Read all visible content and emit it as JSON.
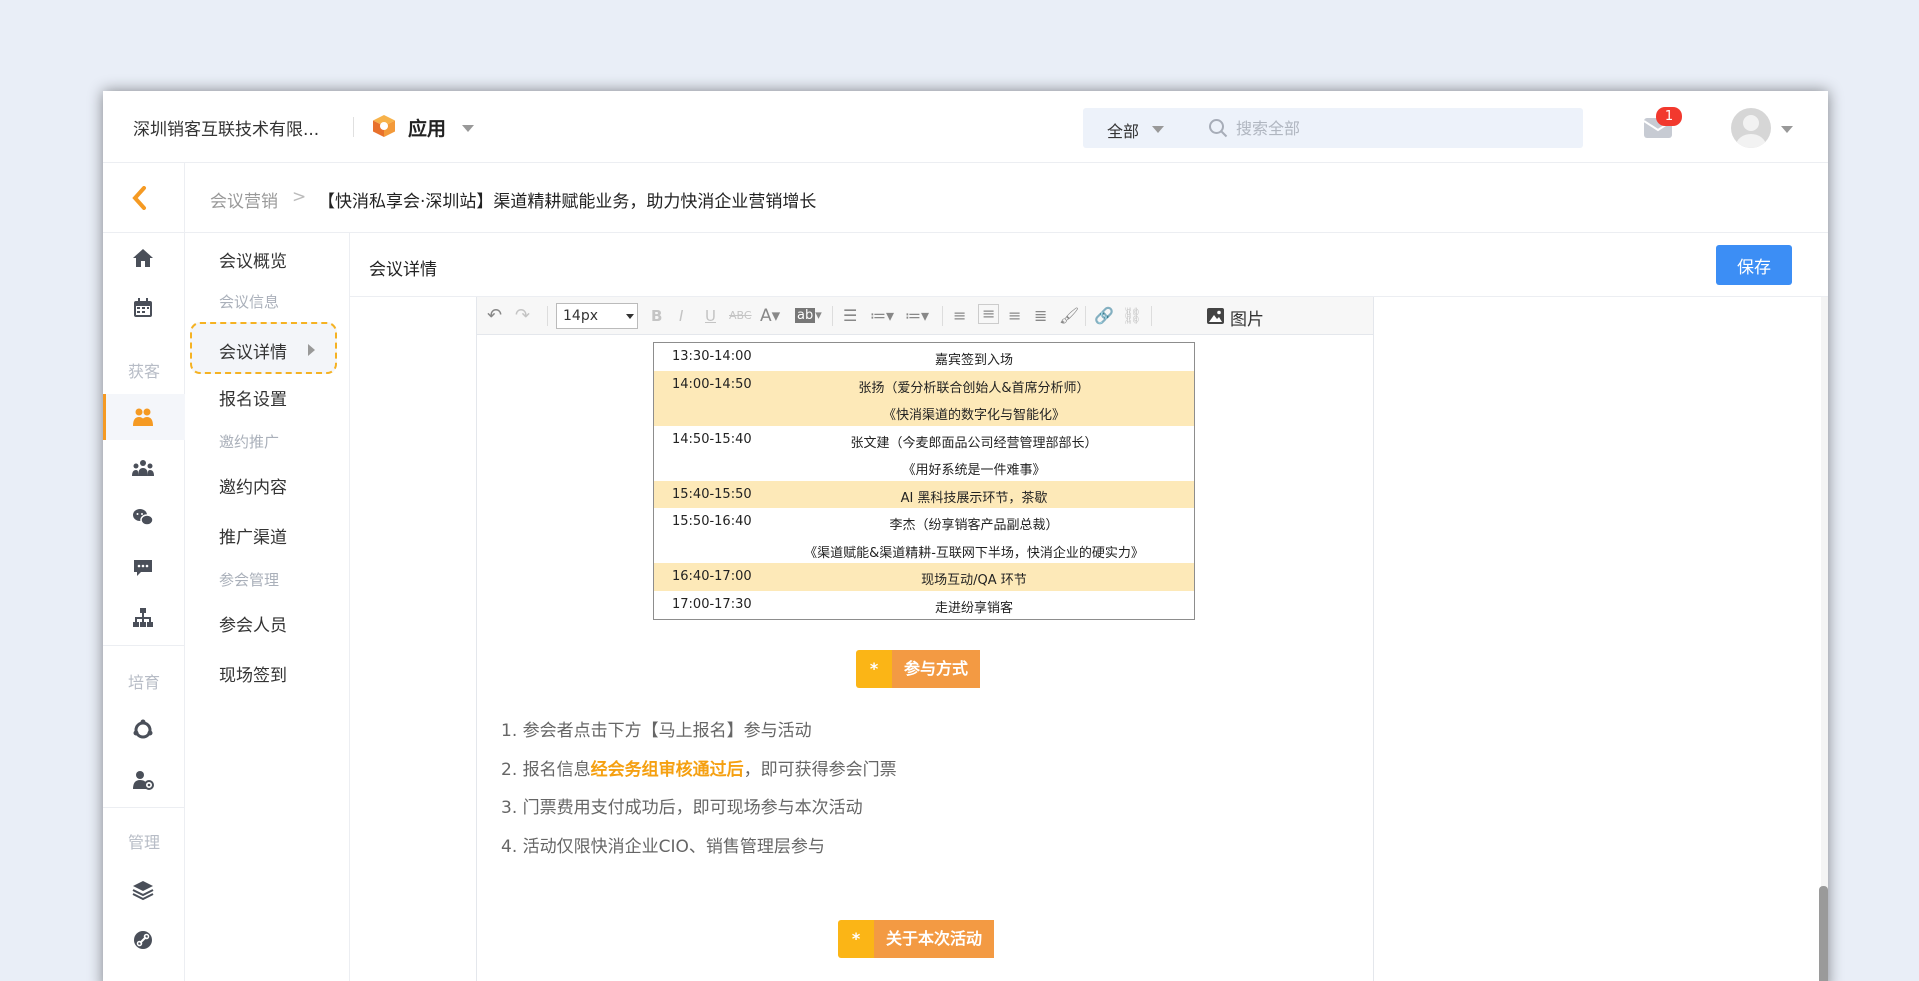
{
  "topbar": {
    "company": "深圳销客互联技术有限...",
    "app_label": "应用",
    "search_scope": "全部",
    "search_placeholder": "搜索全部",
    "mail_badge": "1"
  },
  "breadcrumb": {
    "parent": "会议营销",
    "separator": ">",
    "current": "【快消私享会·深圳站】渠道精耕赋能业务，助力快消企业营销增长"
  },
  "rail": {
    "group_labels": [
      "获客",
      "培育",
      "管理"
    ],
    "icons": [
      "home-icon",
      "calendar-icon",
      "leads-icon",
      "users-group-icon",
      "wechat-icon",
      "chat-icon",
      "org-chart-icon",
      "cycle-icon",
      "user-setting-icon",
      "layers-icon",
      "link-icon"
    ]
  },
  "submenu": {
    "overview": "会议概览",
    "group_info": "会议信息",
    "detail": "会议详情",
    "register": "报名设置",
    "group_invite": "邀约推广",
    "invite_content": "邀约内容",
    "channel": "推广渠道",
    "group_attend": "参会管理",
    "attendees": "参会人员",
    "checkin": "现场签到"
  },
  "content": {
    "title": "会议详情",
    "save_label": "保存"
  },
  "toolbar": {
    "font_size": "14px",
    "image_label": "图片"
  },
  "agenda": [
    {
      "time": "13:30-14:00",
      "text": "嘉宾签到入场",
      "highlight": false
    },
    {
      "time": "14:00-14:50",
      "text": "张扬（爱分析联合创始人&首席分析师）",
      "highlight": true
    },
    {
      "time": "",
      "text": "《快消渠道的数字化与智能化》",
      "highlight": true
    },
    {
      "time": "14:50-15:40",
      "text": "张文建（今麦郎面品公司经营管理部部长）",
      "highlight": false
    },
    {
      "time": "",
      "text": "《用好系统是一件难事》",
      "highlight": false
    },
    {
      "time": "15:40-15:50",
      "text": "AI 黑科技展示环节，茶歇",
      "highlight": true
    },
    {
      "time": "15:50-16:40",
      "text": "李杰（纷享销客产品副总裁）",
      "highlight": false
    },
    {
      "time": "",
      "text": "《渠道赋能&渠道精耕-互联网下半场，快消企业的硬实力》",
      "highlight": false
    },
    {
      "time": "16:40-17:00",
      "text": "现场互动/QA 环节",
      "highlight": true
    },
    {
      "time": "17:00-17:30",
      "text": "走进纷享销客",
      "highlight": false
    }
  ],
  "section1": {
    "star": "*",
    "label": "参与方式"
  },
  "steps": {
    "s1": "1. 参会者点击下方【马上报名】参与活动",
    "s2_pre": "2. 报名信息",
    "s2_hi": "经会务组审核通过后",
    "s2_post": "，即可获得参会门票",
    "s3": "3. 门票费用支付成功后，即可现场参与本次活动",
    "s4": "4. 活动仅限快消企业CIO、销售管理层参与"
  },
  "section2": {
    "star": "*",
    "label": "关于本次活动"
  },
  "colors": {
    "accent_orange": "#f59a23",
    "primary_blue": "#3c8ef5",
    "highlight_row": "#fde9b8",
    "tag_orange": "#f39a43",
    "tag_yellow": "#fbb516",
    "badge_red": "#f2392e"
  }
}
